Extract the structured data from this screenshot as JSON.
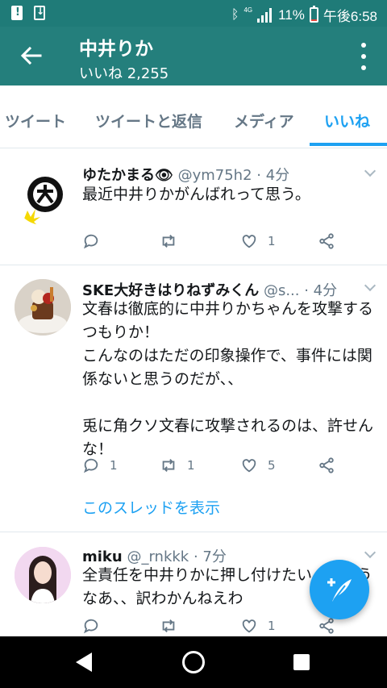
{
  "status_bar": {
    "network": "4G",
    "battery_percent": "11%",
    "time": "午後6:58",
    "battery_level": 0.11,
    "icons": [
      "alert-icon",
      "download-icon",
      "bluetooth-icon",
      "signal-icon",
      "battery-icon"
    ]
  },
  "app_bar": {
    "title": "中井りか",
    "subtitle": "いいね 2,255"
  },
  "tabs": [
    {
      "label": "ツイート",
      "active": false
    },
    {
      "label": "ツイートと返信",
      "active": false
    },
    {
      "label": "メディア",
      "active": false
    },
    {
      "label": "いいね",
      "active": true
    }
  ],
  "tweets": [
    {
      "name": "ゆたかまる👁",
      "handle": "@ym75h2",
      "time": "· 4分",
      "text": "最近中井りかがんばれって思う。",
      "reply_count": "",
      "retweet_count": "",
      "like_count": "1"
    },
    {
      "name": "SKE大好きはりねずみくん",
      "handle": "@s...",
      "time": "· 4分",
      "text": "文春は徹底的に中井りかちゃんを攻撃するつもりか！\nこんなのはただの印象操作で、事件には関係ないと思うのだが、、\n\n兎に角クソ文春に攻撃されるのは、許せんな！",
      "reply_count": "1",
      "retweet_count": "1",
      "like_count": "5",
      "thread_link": "このスレッドを表示"
    },
    {
      "name": "miku",
      "handle": "@_rnkkk",
      "time": "· 7分",
      "text": "全責任を中井りかに押し付けたいんだろうなあ、、訳わかんねえわ",
      "reply_count": "",
      "retweet_count": "",
      "like_count": "1"
    }
  ],
  "colors": {
    "header": "#247f7c",
    "accent": "#1da1f2",
    "muted": "#657786"
  }
}
